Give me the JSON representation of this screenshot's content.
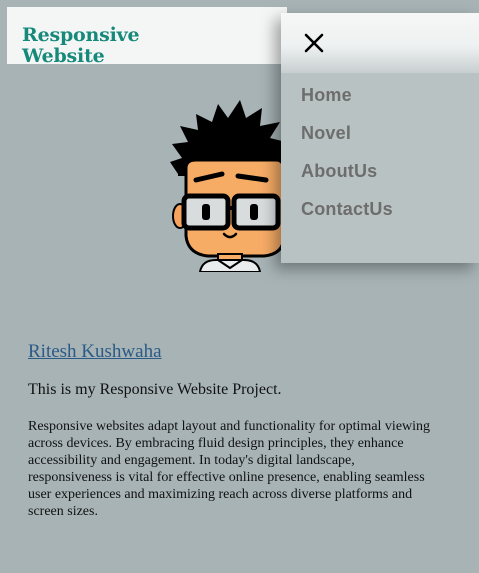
{
  "header": {
    "logo_line1": "Responsive",
    "logo_line2": "Website"
  },
  "menu": {
    "close_icon": "close-icon",
    "items": [
      {
        "label": "Home"
      },
      {
        "label": "Novel"
      },
      {
        "label": "AboutUs"
      },
      {
        "label": "ContactUs"
      }
    ]
  },
  "content": {
    "author_link": "Ritesh Kushwaha",
    "tagline": "This is my Responsive Website Project.",
    "description": "Responsive websites adapt layout and functionality for optimal viewing across devices. By embracing fluid design principles, they enhance accessibility and engagement. In today's digital landscape, responsiveness is vital for effective online presence, enabling seamless user experiences and maximizing reach across diverse platforms and screen sizes."
  },
  "colors": {
    "page_background": "#a7b3b5",
    "logo": "#16897a",
    "link": "#2b5a86",
    "menu_background": "#b9c2c3",
    "menu_text": "#6d6d6d"
  }
}
